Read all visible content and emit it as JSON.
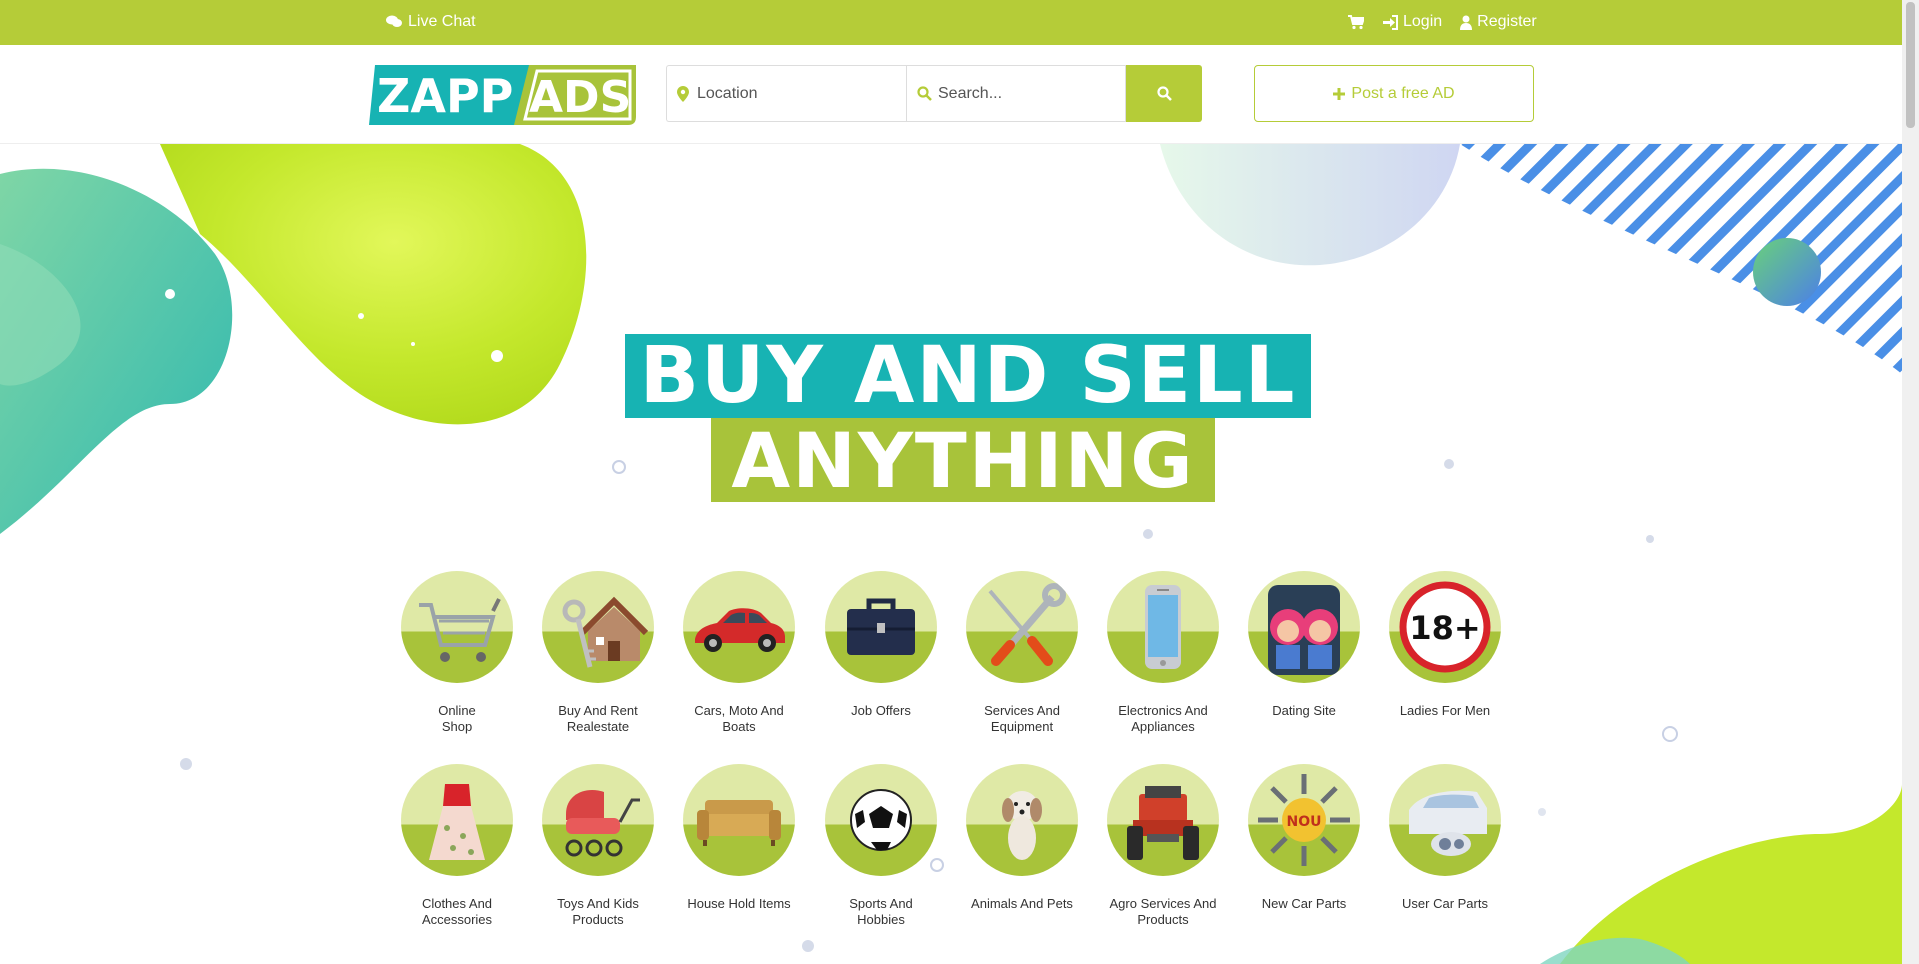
{
  "topbar": {
    "live_chat": "Live Chat",
    "login": "Login",
    "register": "Register"
  },
  "header": {
    "logo_left": "ZAPP",
    "logo_right": "ADS",
    "location_placeholder": "Location",
    "search_placeholder": "Search...",
    "post_ad": "Post a free AD"
  },
  "hero": {
    "line1": "BUY AND SELL",
    "line2": "ANYTHING"
  },
  "categories": [
    {
      "label": "Online\nShop",
      "icon": "shopping-cart-icon"
    },
    {
      "label": "Buy And Rent\nRealestate",
      "icon": "house-keys-icon"
    },
    {
      "label": "Cars, Moto And\nBoats",
      "icon": "car-icon"
    },
    {
      "label": "Job Offers",
      "icon": "briefcase-icon"
    },
    {
      "label": "Services And\nEquipment",
      "icon": "tools-icon"
    },
    {
      "label": "Electronics And\nAppliances",
      "icon": "smartphone-icon"
    },
    {
      "label": "Dating Site",
      "icon": "couple-icon"
    },
    {
      "label": "Ladies For Men",
      "icon": "adult-18-icon"
    },
    {
      "label": "Clothes And\nAccessories",
      "icon": "dress-icon"
    },
    {
      "label": "Toys And Kids\nProducts",
      "icon": "stroller-icon"
    },
    {
      "label": "House Hold Items",
      "icon": "sofa-icon"
    },
    {
      "label": "Sports And\nHobbies",
      "icon": "soccer-ball-icon"
    },
    {
      "label": "Animals And Pets",
      "icon": "dog-icon"
    },
    {
      "label": "Agro Services And\nProducts",
      "icon": "tractor-icon"
    },
    {
      "label": "New Car Parts",
      "icon": "car-parts-icon"
    },
    {
      "label": "User Car Parts",
      "icon": "headlight-icon"
    }
  ],
  "colors": {
    "brand_green": "#b5cc38",
    "brand_teal": "#17b3b3"
  }
}
